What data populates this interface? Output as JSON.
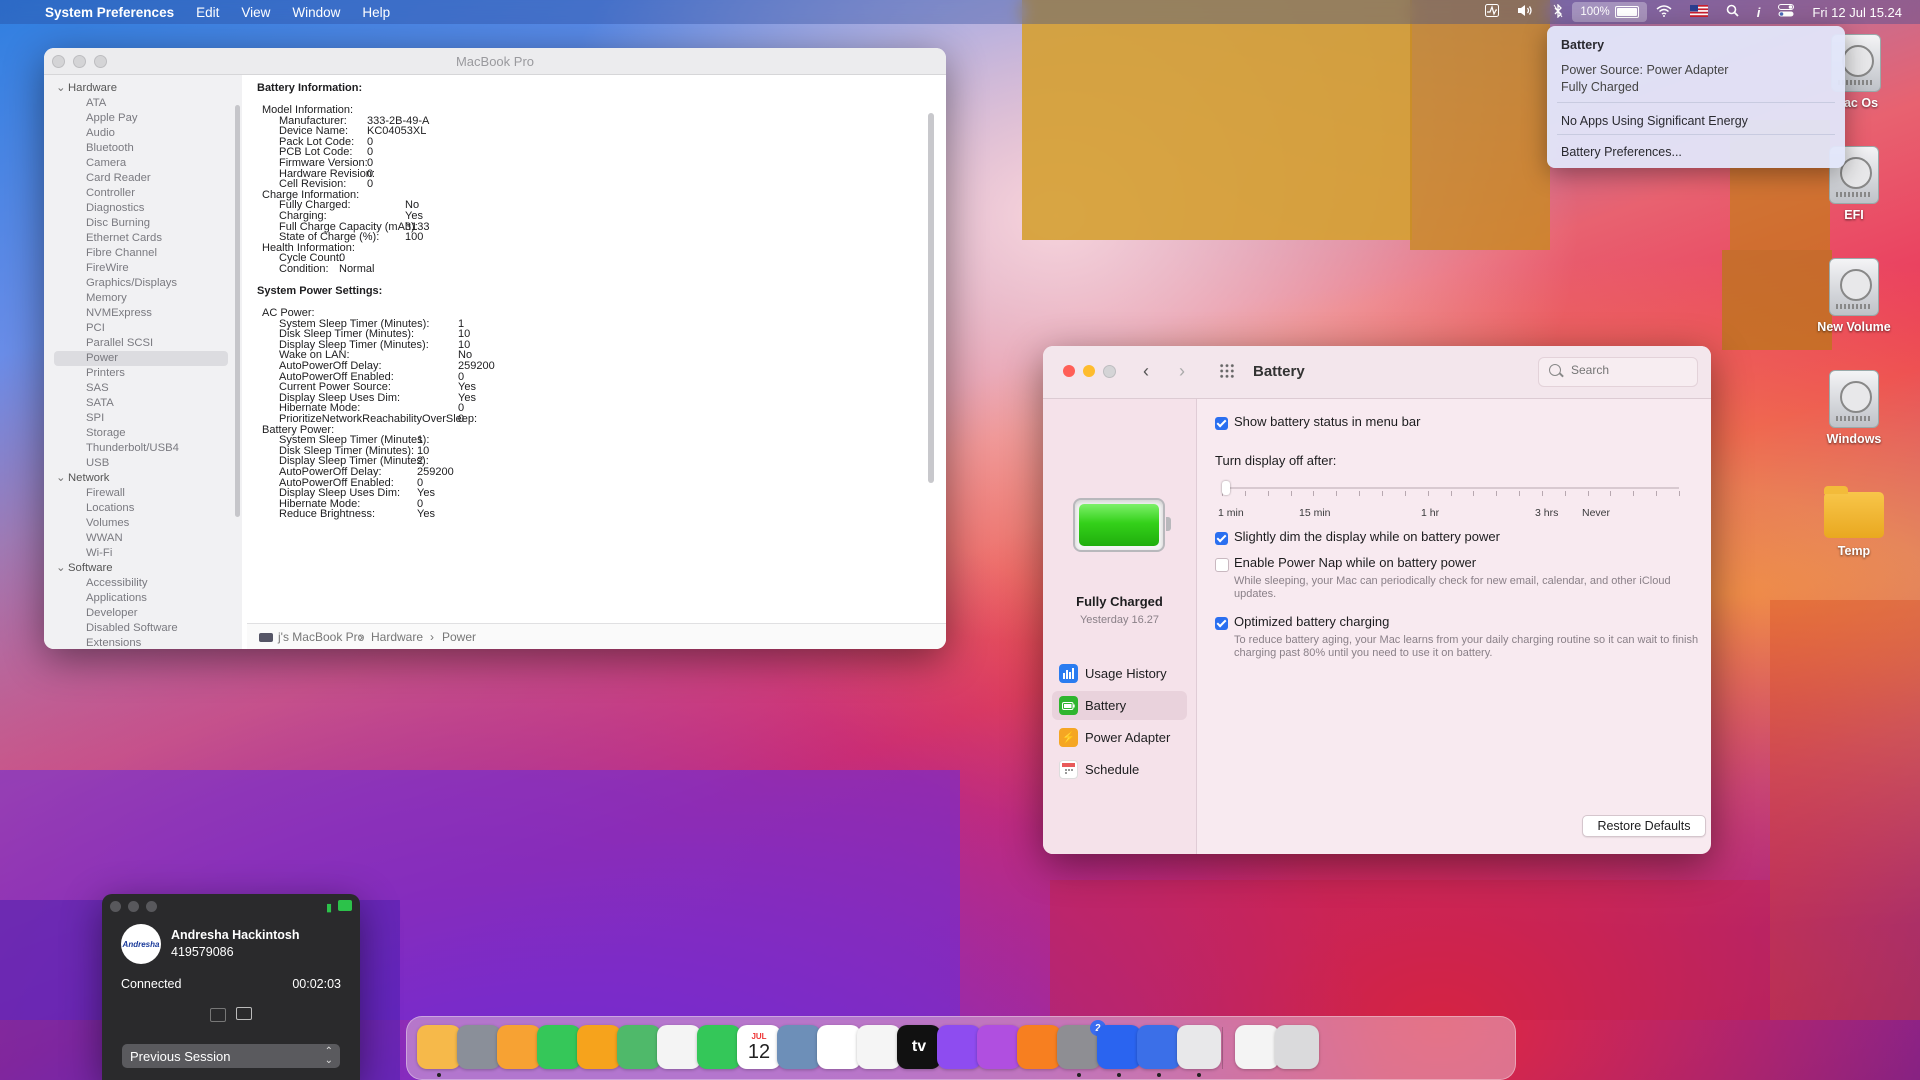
{
  "menubar": {
    "apple": "",
    "app_name": "System Preferences",
    "menus": [
      "Edit",
      "View",
      "Window",
      "Help"
    ],
    "battery_percent": "100%",
    "clock": "Fri 12 Jul  15.24",
    "status_icons": [
      "activity-monitor-icon",
      "volume-icon",
      "bluetooth-icon",
      "battery-icon",
      "wifi-icon",
      "us-flag-icon",
      "spotlight-icon",
      "info-icon",
      "control-center-icon"
    ]
  },
  "battery_popup": {
    "title": "Battery",
    "power_source": "Power Source: Power Adapter",
    "state": "Fully Charged",
    "energy": "No Apps Using Significant Energy",
    "prefs_link": "Battery Preferences..."
  },
  "desktop_icons": [
    {
      "label": "ac Os",
      "icon": "hard-disk-icon"
    },
    {
      "label": "EFI",
      "icon": "hard-disk-icon"
    },
    {
      "label": "New Volume",
      "icon": "hard-disk-icon"
    },
    {
      "label": "Windows",
      "icon": "hard-disk-icon"
    },
    {
      "label": "Temp",
      "icon": "folder-icon"
    }
  ],
  "sysinfo": {
    "title": "MacBook Pro",
    "sidebar": {
      "hardware_label": "Hardware",
      "hardware_items": [
        "ATA",
        "Apple Pay",
        "Audio",
        "Bluetooth",
        "Camera",
        "Card Reader",
        "Controller",
        "Diagnostics",
        "Disc Burning",
        "Ethernet Cards",
        "Fibre Channel",
        "FireWire",
        "Graphics/Displays",
        "Memory",
        "NVMExpress",
        "PCI",
        "Parallel SCSI",
        "Power",
        "Printers",
        "SAS",
        "SATA",
        "SPI",
        "Storage",
        "Thunderbolt/USB4",
        "USB"
      ],
      "network_label": "Network",
      "network_items": [
        "Firewall",
        "Locations",
        "Volumes",
        "WWAN",
        "Wi-Fi"
      ],
      "software_label": "Software",
      "software_items": [
        "Accessibility",
        "Applications",
        "Developer",
        "Disabled Software",
        "Extensions"
      ],
      "selected": "Power"
    },
    "content": {
      "battery_heading": "Battery Information:",
      "model_heading": "Model Information:",
      "model_rows": [
        [
          "Manufacturer:",
          "333-2B-49-A"
        ],
        [
          "Device Name:",
          "KC04053XL"
        ],
        [
          "Pack Lot Code:",
          "0"
        ],
        [
          "PCB Lot Code:",
          "0"
        ],
        [
          "Firmware Version:",
          "0"
        ],
        [
          "Hardware Revision:",
          "0"
        ],
        [
          "Cell Revision:",
          "0"
        ]
      ],
      "charge_heading": "Charge Information:",
      "charge_rows": [
        [
          "Fully Charged:",
          "No"
        ],
        [
          "Charging:",
          "Yes"
        ],
        [
          "Full Charge Capacity (mAh):",
          "3133"
        ],
        [
          "State of Charge (%):",
          "100"
        ]
      ],
      "health_heading": "Health Information:",
      "health_rows": [
        [
          "Cycle Count:",
          "0"
        ],
        [
          "Condition:",
          "Normal"
        ]
      ],
      "power_heading": "System Power Settings:",
      "ac_heading": "AC Power:",
      "ac_rows": [
        [
          "System Sleep Timer (Minutes):",
          "1"
        ],
        [
          "Disk Sleep Timer (Minutes):",
          "10"
        ],
        [
          "Display Sleep Timer (Minutes):",
          "10"
        ],
        [
          "Wake on LAN:",
          "No"
        ],
        [
          "AutoPowerOff Delay:",
          "259200"
        ],
        [
          "AutoPowerOff Enabled:",
          "0"
        ],
        [
          "Current Power Source:",
          "Yes"
        ],
        [
          "Display Sleep Uses Dim:",
          "Yes"
        ],
        [
          "Hibernate Mode:",
          "0"
        ],
        [
          "PrioritizeNetworkReachabilityOverSleep:",
          "0"
        ]
      ],
      "bat_heading": "Battery Power:",
      "bat_rows": [
        [
          "System Sleep Timer (Minutes):",
          "1"
        ],
        [
          "Disk Sleep Timer (Minutes):",
          "10"
        ],
        [
          "Display Sleep Timer (Minutes):",
          "2"
        ],
        [
          "AutoPowerOff Delay:",
          "259200"
        ],
        [
          "AutoPowerOff Enabled:",
          "0"
        ],
        [
          "Display Sleep Uses Dim:",
          "Yes"
        ],
        [
          "Hibernate Mode:",
          "0"
        ],
        [
          "Reduce Brightness:",
          "Yes"
        ]
      ]
    },
    "path": [
      "j's MacBook Pro",
      "Hardware",
      "Power"
    ]
  },
  "battery_prefs": {
    "title": "Battery",
    "search_placeholder": "Search",
    "status_title": "Fully Charged",
    "status_time": "Yesterday 16.27",
    "nav": [
      {
        "label": "Usage History",
        "icon": "usage-history-icon",
        "color": "#2a7cf0"
      },
      {
        "label": "Battery",
        "icon": "battery-icon",
        "color": "#2fb52f"
      },
      {
        "label": "Power Adapter",
        "icon": "power-adapter-icon",
        "color": "#f5a623"
      },
      {
        "label": "Schedule",
        "icon": "calendar-icon",
        "color": "#e85a5a"
      }
    ],
    "selected_nav": "Battery",
    "show_status": {
      "label": "Show battery status in menu bar",
      "checked": true
    },
    "display_off_label": "Turn display off after:",
    "slider_labels": [
      "1 min",
      "15 min",
      "1 hr",
      "3 hrs",
      "Never"
    ],
    "slider_value": "1 min",
    "dim": {
      "label": "Slightly dim the display while on battery power",
      "checked": true
    },
    "power_nap": {
      "label": "Enable Power Nap while on battery power",
      "checked": false,
      "desc": "While sleeping, your Mac can periodically check for new email, calendar, and other iCloud updates."
    },
    "optimized": {
      "label": "Optimized battery charging",
      "checked": true,
      "desc": "To reduce battery aging, your Mac learns from your daily charging routine so it can wait to finish charging past 80% until you need to use it on battery."
    },
    "restore_label": "Restore Defaults",
    "help_label": "?"
  },
  "session": {
    "name": "Andresha Hackintosh",
    "id": "419579086",
    "status": "Connected",
    "duration": "00:02:03",
    "avatar_text": "Andresha",
    "previous_label": "Previous Session"
  },
  "dock": {
    "apps": [
      {
        "name": "finder",
        "color": "#f6b94a"
      },
      {
        "name": "launchpad",
        "color": "#8a8f99"
      },
      {
        "name": "safari",
        "color": "#f7a233"
      },
      {
        "name": "messages",
        "color": "#35c759"
      },
      {
        "name": "mail",
        "color": "#f6a31c"
      },
      {
        "name": "maps",
        "color": "#4fb96a"
      },
      {
        "name": "photos",
        "color": "#f4f4f4"
      },
      {
        "name": "facetime",
        "color": "#34c759"
      },
      {
        "name": "calendar",
        "color": "#ffffff",
        "month": "JUL",
        "day": "12"
      },
      {
        "name": "contacts",
        "color": "#6d8fb8"
      },
      {
        "name": "reminders",
        "color": "#ffffff"
      },
      {
        "name": "notes",
        "color": "#f5f5f5"
      },
      {
        "name": "apple-tv",
        "color": "#111111",
        "text": "tv"
      },
      {
        "name": "music",
        "color": "#8e4cf0"
      },
      {
        "name": "podcasts",
        "color": "#b04fe0"
      },
      {
        "name": "app-store",
        "color": "#f77f20"
      },
      {
        "name": "system-preferences",
        "color": "#8e8e93",
        "badge": "2"
      },
      {
        "name": "teamviewer",
        "color": "#2a64f0"
      },
      {
        "name": "teamviewer-host",
        "color": "#3b6fe8"
      },
      {
        "name": "printer",
        "color": "#e8e8ea"
      },
      {
        "name": "downloads-stack",
        "color": "#f4f4f4"
      },
      {
        "name": "trash",
        "color": "#dadadc"
      }
    ]
  }
}
